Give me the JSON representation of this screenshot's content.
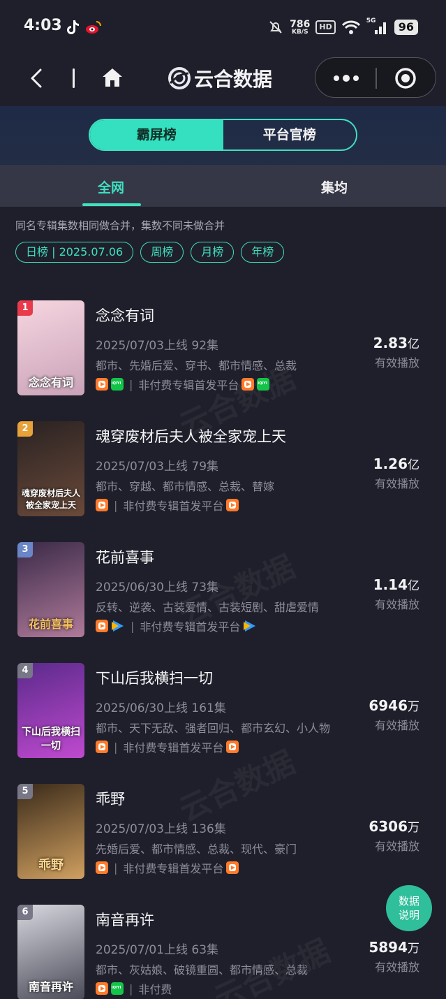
{
  "status_bar": {
    "time": "4:03",
    "net_speed": "786",
    "net_unit": "KB/S",
    "hd": "HD",
    "signal": "5G",
    "battery": "96"
  },
  "nav": {
    "title": "云合数据"
  },
  "switcher": {
    "items": [
      "霸屏榜",
      "平台官榜"
    ],
    "active": 0
  },
  "tabs": {
    "items": [
      "全网",
      "集均"
    ],
    "active": 0
  },
  "note": "同名专辑集数相同做合并，集数不同未做合并",
  "filters": [
    "日榜 | 2025.07.06",
    "周榜",
    "月榜",
    "年榜"
  ],
  "list": [
    {
      "rank": "1",
      "rank_color": "#e83a4a",
      "poster_text": "念念有词",
      "poster_colors": [
        "#f6d6e0",
        "#c9a2b8"
      ],
      "title": "念念有词",
      "meta": "2025/07/03上线 92集",
      "tags": "都市、先婚后爱、穿书、都市情感、总裁",
      "platform_note": "非付费专辑首发平台",
      "icons_before": [
        "mgtv",
        "iqiyi"
      ],
      "icons_after": [
        "mgtv",
        "iqiyi"
      ],
      "value": "2.83",
      "unit": "亿",
      "value_caption": "有效播放"
    },
    {
      "rank": "2",
      "rank_color": "#e8a23a",
      "poster_text": "魂穿废材后夫人被全家宠上天",
      "poster_colors": [
        "#2a2222",
        "#6a4a3a"
      ],
      "title": "魂穿废材后夫人被全家宠上天",
      "meta": "2025/07/03上线 79集",
      "tags": "都市、穿越、都市情感、总裁、替嫁",
      "platform_note": "非付费专辑首发平台",
      "icons_before": [
        "mgtv"
      ],
      "icons_after": [
        "mgtv"
      ],
      "value": "1.26",
      "unit": "亿",
      "value_caption": "有效播放"
    },
    {
      "rank": "3",
      "rank_color": "#6a86c8",
      "poster_text": "花前喜事",
      "poster_colors": [
        "#3a2a48",
        "#b07a9a"
      ],
      "title": "花前喜事",
      "meta": "2025/06/30上线 73集",
      "tags": "反转、逆袭、古装爱情、古装短剧、甜虐爱情",
      "platform_note": "非付费专辑首发平台",
      "icons_before": [
        "mgtv",
        "tencent"
      ],
      "icons_after": [
        "tencent"
      ],
      "value": "1.14",
      "unit": "亿",
      "value_caption": "有效播放"
    },
    {
      "rank": "4",
      "rank_color": "#777788",
      "poster_text": "下山后我横扫一切",
      "poster_colors": [
        "#5a2a8a",
        "#c04ad0"
      ],
      "title": "下山后我横扫一切",
      "meta": "2025/06/30上线 161集",
      "tags": "都市、天下无敌、强者回归、都市玄幻、小人物",
      "platform_note": "非付费专辑首发平台",
      "icons_before": [
        "mgtv"
      ],
      "icons_after": [
        "mgtv"
      ],
      "value": "6946",
      "unit": "万",
      "value_caption": "有效播放"
    },
    {
      "rank": "5",
      "rank_color": "#777788",
      "poster_text": "乖野",
      "poster_colors": [
        "#3a2a1a",
        "#d0a060"
      ],
      "title": "乖野",
      "meta": "2025/07/03上线 136集",
      "tags": "先婚后爱、都市情感、总裁、现代、豪门",
      "platform_note": "非付费专辑首发平台",
      "icons_before": [
        "mgtv"
      ],
      "icons_after": [
        "mgtv"
      ],
      "value": "6306",
      "unit": "万",
      "value_caption": "有效播放"
    },
    {
      "rank": "6",
      "rank_color": "#777788",
      "poster_text": "南音再许",
      "poster_colors": [
        "#d8d8e0",
        "#4a4a58"
      ],
      "title": "南音再许",
      "meta": "2025/07/01上线 63集",
      "tags": "都市、灰姑娘、破镜重圆、都市情感、总裁",
      "platform_note": "非付费",
      "icons_before": [
        "mgtv",
        "iqiyi"
      ],
      "icons_after": [],
      "value": "5894",
      "unit": "万",
      "value_caption": "有效播放"
    }
  ],
  "fab": {
    "line1": "数据",
    "line2": "说明"
  },
  "watermark": "云合数据"
}
